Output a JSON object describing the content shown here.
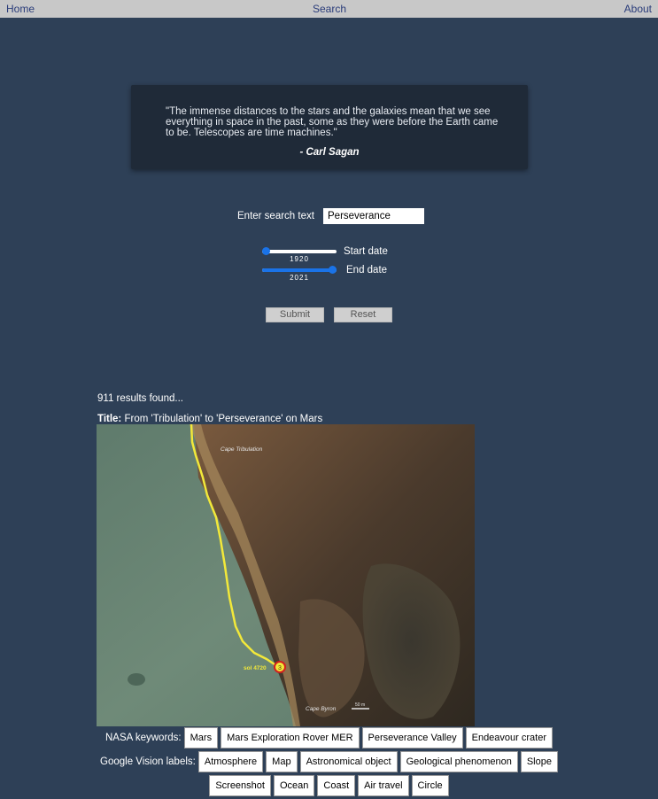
{
  "nav": {
    "home": "Home",
    "search": "Search",
    "about": "About"
  },
  "quote": {
    "text": "\"The immense distances to the stars and the galaxies mean that we see everything in space in the past, some as they were before the Earth came to be. Telescopes are time machines.\"",
    "author": "- Carl Sagan"
  },
  "search": {
    "label": "Enter search text",
    "value": "Perseverance"
  },
  "dates": {
    "start_label": "Start date",
    "start_value": "1920",
    "end_label": "End date",
    "end_value": "2021",
    "min": 1920,
    "max": 2021
  },
  "buttons": {
    "submit": "Submit",
    "reset": "Reset"
  },
  "results": {
    "count_text": "911 results found...",
    "title_label": "Title:",
    "title": "From 'Tribulation' to 'Perseverance' on Mars",
    "image_labels": {
      "cape_tribulation": "Cape Tribulation",
      "sol": "sol 4720",
      "cape_byron": "Cape Byron",
      "scale": "50 m",
      "marker": "3"
    }
  },
  "nasa_keywords": {
    "label": "NASA keywords:",
    "items": [
      "Mars",
      "Mars Exploration Rover MER",
      "Perseverance Valley",
      "Endeavour crater"
    ]
  },
  "vision_labels": {
    "label": "Google Vision labels:",
    "items": [
      "Atmosphere",
      "Map",
      "Astronomical object",
      "Geological phenomenon",
      "Slope",
      "Screenshot",
      "Ocean",
      "Coast",
      "Air travel",
      "Circle"
    ]
  },
  "colors": {
    "background": "#2e4057",
    "navbar": "#c8c8c8",
    "quote_bg": "#1f2a38",
    "slider": "#1a73e8",
    "route": "#f2e83a"
  }
}
